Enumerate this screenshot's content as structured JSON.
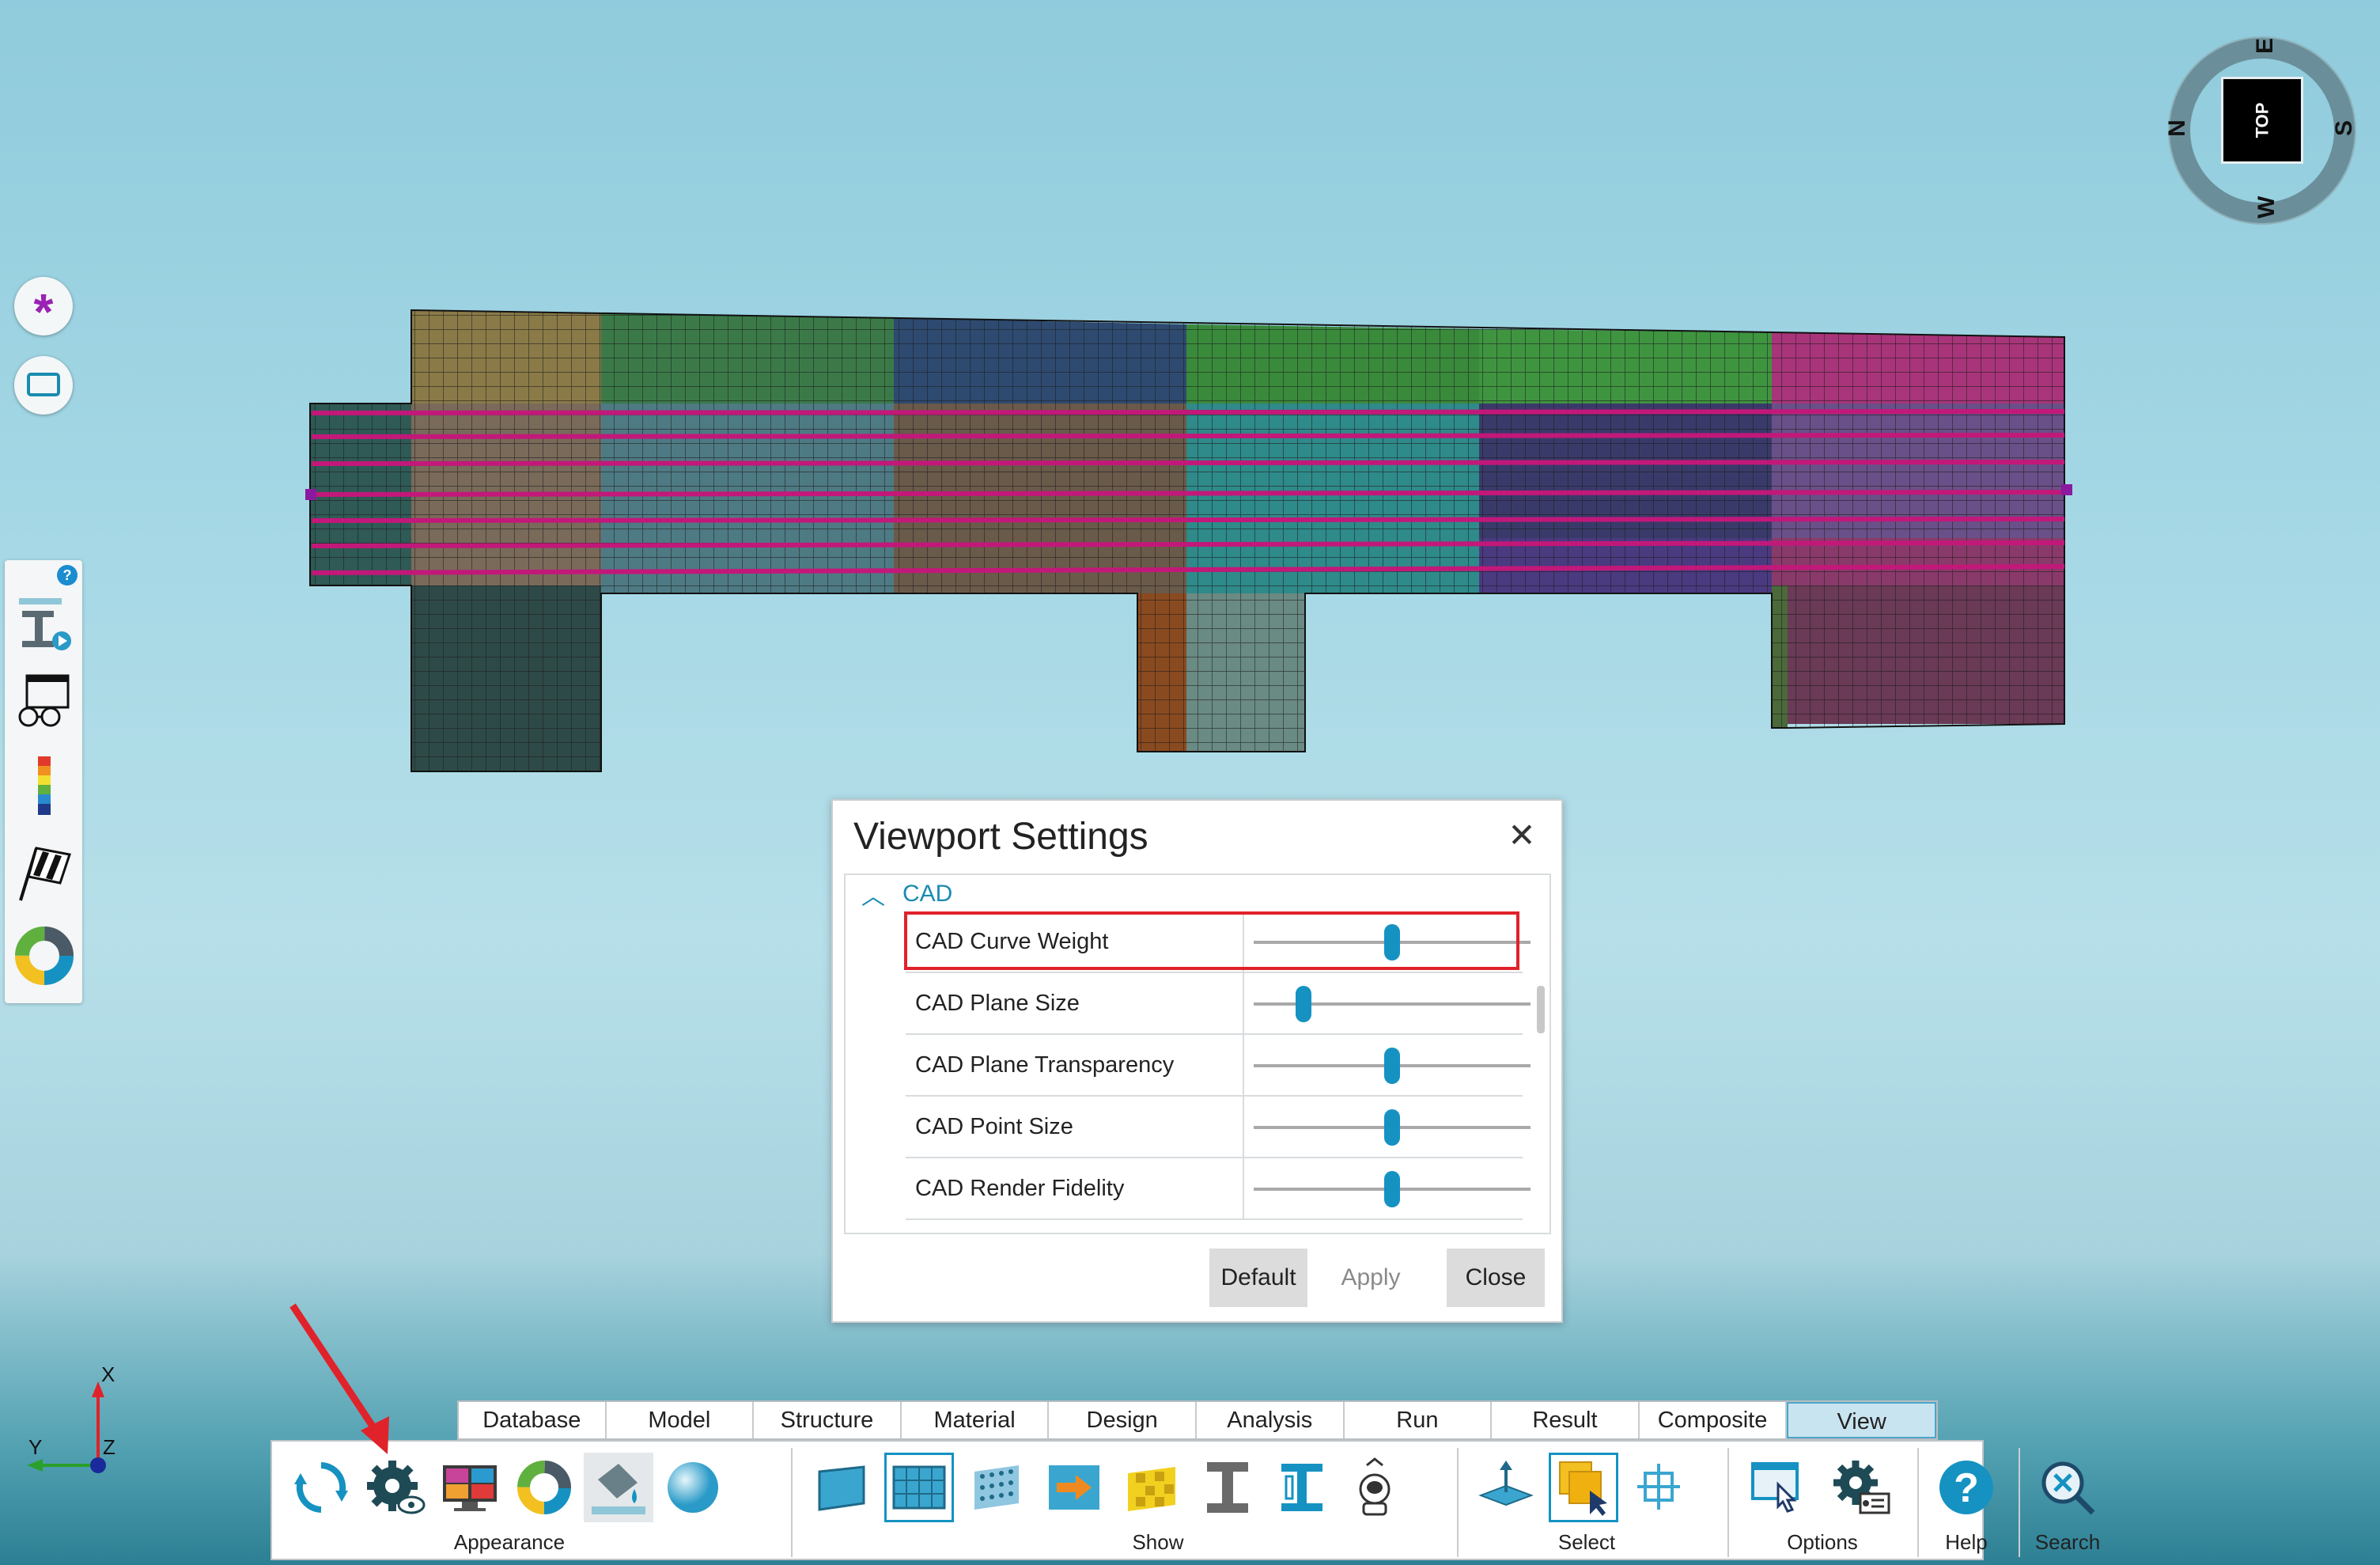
{
  "compass": {
    "top_label": "TOP",
    "n": "N",
    "e": "E",
    "s": "S",
    "w": "W"
  },
  "dialog": {
    "title": "Viewport Settings",
    "close_glyph": "✕",
    "section": "CAD",
    "rows": [
      {
        "label": "CAD Curve Weight",
        "value": 0.5
      },
      {
        "label": "CAD Plane Size",
        "value": 0.18
      },
      {
        "label": "CAD Plane Transparency",
        "value": 0.5
      },
      {
        "label": "CAD Point Size",
        "value": 0.5
      },
      {
        "label": "CAD Render Fidelity",
        "value": 0.5
      }
    ],
    "buttons": {
      "default": "Default",
      "apply": "Apply",
      "close": "Close"
    }
  },
  "tabs": [
    "Database",
    "Model",
    "Structure",
    "Material",
    "Design",
    "Analysis",
    "Run",
    "Result",
    "Composite",
    "View"
  ],
  "active_tab": "View",
  "ribbon_groups": {
    "appearance": "Appearance",
    "show": "Show",
    "select": "Select",
    "options": "Options",
    "help": "Help",
    "search": "Search"
  },
  "axis": {
    "x": "X",
    "y": "Y",
    "z": "Z"
  },
  "colors": {
    "accent": "#1592c2",
    "highlight": "#e0222a",
    "cad_curve": "#c2187a"
  }
}
